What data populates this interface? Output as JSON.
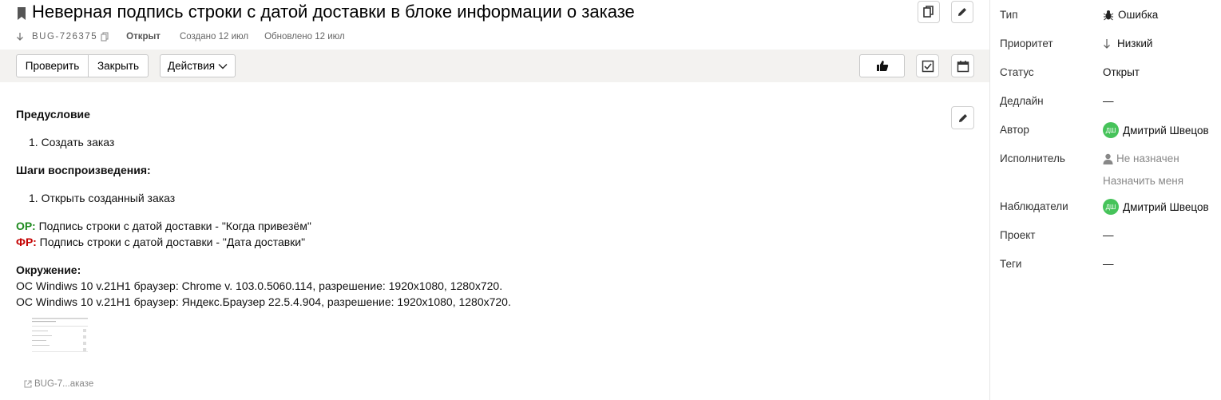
{
  "issue": {
    "title": "Неверная подпись строки с датой доставки в блоке информации о заказе",
    "key": "BUG-726375",
    "status": "Открыт",
    "created": "Создано 12 июл",
    "updated": "Обновлено 12 июл"
  },
  "toolbar": {
    "check_label": "Проверить",
    "close_label": "Закрыть",
    "actions_label": "Действия"
  },
  "description": {
    "precondition_title": "Предусловие",
    "precondition_items": [
      "1. Создать заказ"
    ],
    "steps_title": "Шаги воспроизведения:",
    "steps_items": [
      "1. Открыть созданный заказ"
    ],
    "expected_label": "ОР:",
    "expected_text": " Подпись строки с датой доставки - \"Когда привезём\"",
    "actual_label": "ФР:",
    "actual_text": " Подпись строки с датой доставки - \"Дата доставки\"",
    "env_title": "Окружение:",
    "env_lines": [
      "ОС Windiws 10 v.21H1 браузер: Chrome v. 103.0.5060.114, разрешение: 1920x1080, 1280x720.",
      "ОС Windiws 10 v.21H1 браузер: Яндекс.Браузер 22.5.4.904, разрешение: 1920x1080, 1280x720."
    ],
    "attachment_name": "BUG-7...аказе"
  },
  "sidebar": {
    "type_label": "Тип",
    "type_value": "Ошибка",
    "priority_label": "Приоритет",
    "priority_value": "Низкий",
    "status_label": "Статус",
    "status_value": "Открыт",
    "deadline_label": "Дедлайн",
    "deadline_value": "—",
    "author_label": "Автор",
    "author_initials": "ДШ",
    "author_value": "Дмитрий Швецов",
    "assignee_label": "Исполнитель",
    "assignee_value": "Не назначен",
    "assign_me": "Назначить меня",
    "watchers_label": "Наблюдатели",
    "watcher_initials": "ДШ",
    "watcher_value": "Дмитрий Швецов",
    "project_label": "Проект",
    "project_value": "—",
    "tags_label": "Теги",
    "tags_value": "—"
  },
  "colors": {
    "expected": "#1e8a1e",
    "actual": "#c40000",
    "avatar": "#46c35a",
    "toolbar_bg": "#f3f2f0"
  }
}
